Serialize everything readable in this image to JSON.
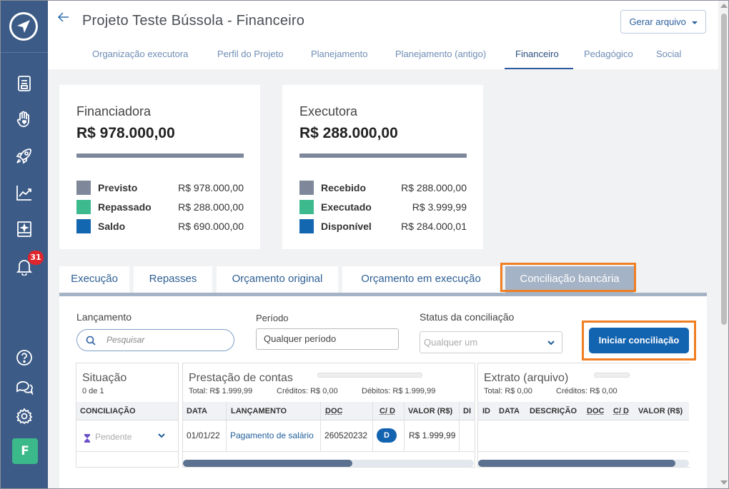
{
  "header": {
    "title": "Projeto Teste Bússola - Financeiro",
    "generate_label": "Gerar arquivo"
  },
  "tabs_top": [
    {
      "label": "Organização executora"
    },
    {
      "label": "Perfil do Projeto"
    },
    {
      "label": "Planejamento"
    },
    {
      "label": "Planejamento (antigo)"
    },
    {
      "label": "Financeiro",
      "active": true
    },
    {
      "label": "Pedagógico"
    },
    {
      "label": "Social"
    }
  ],
  "sidebar": {
    "icons": [
      "compass-logo-icon",
      "document-icon",
      "hand-heart-icon",
      "rocket-icon",
      "chart-line-icon",
      "book-icon",
      "bell-icon",
      "help-icon",
      "chat-icon",
      "gear-icon"
    ],
    "notification_count": "31",
    "avatar_letter": "F"
  },
  "cards": {
    "financiadora": {
      "title": "Financiadora",
      "amount": "R$ 978.000,00",
      "rows": [
        {
          "label": "Previsto",
          "value": "R$ 978.000,00",
          "color": "#7e889a"
        },
        {
          "label": "Repassado",
          "value": "R$ 288.000,00",
          "color": "#3dba8d"
        },
        {
          "label": "Saldo",
          "value": "R$ 690.000,00",
          "color": "#1366b0"
        }
      ]
    },
    "executora": {
      "title": "Executora",
      "amount": "R$ 288.000,00",
      "rows": [
        {
          "label": "Recebido",
          "value": "R$ 288.000,00",
          "color": "#7e889a"
        },
        {
          "label": "Executado",
          "value": "R$ 3.999,99",
          "color": "#3dba8d"
        },
        {
          "label": "Disponível",
          "value": "R$ 284.000,01",
          "color": "#1366b0"
        }
      ]
    }
  },
  "tabs_bottom": [
    {
      "label": "Execução"
    },
    {
      "label": "Repasses"
    },
    {
      "label": "Orçamento original"
    },
    {
      "label": "Orçamento em execução"
    },
    {
      "label": "Conciliação bancária",
      "active": true
    }
  ],
  "filters": {
    "lancamento_label": "Lançamento",
    "search_placeholder": "Pesquisar",
    "periodo_label": "Período",
    "periodo_value": "Qualquer período",
    "status_label": "Status da conciliação",
    "status_placeholder": "Qualquer um",
    "start_button": "Iniciar conciliação"
  },
  "situacao": {
    "title": "Situação",
    "count": "0 de 1",
    "column": "CONCILIAÇÃO",
    "status": "Pendente"
  },
  "prestacao": {
    "title": "Prestação de contas",
    "total": "Total: R$ 1.999,99",
    "creditos": "Créditos: R$ 0,00",
    "debitos": "Débitos: R$ 1.999,99",
    "columns": [
      "DATA",
      "LANÇAMENTO",
      "DOC",
      "C/ D",
      "VALOR (R$)",
      "DI"
    ],
    "rows": [
      {
        "data": "01/01/22",
        "lancamento": "Pagamento de salário",
        "doc": "260520232",
        "cd": "D",
        "valor": "R$ 1.999,99"
      }
    ]
  },
  "extrato": {
    "title": "Extrato (arquivo)",
    "total": "Total: R$ 0,00",
    "creditos": "Créditos: R$ 0,00",
    "columns": [
      "ID",
      "DATA",
      "DESCRIÇÃO",
      "DOC",
      "C/ D",
      "VALOR (R$)"
    ]
  },
  "colors": {
    "sidebar": "#3c5b86",
    "accent": "#1263b0",
    "highlight": "#f07e22",
    "active_tab": "#a5b3c6",
    "green": "#3dba8d"
  }
}
